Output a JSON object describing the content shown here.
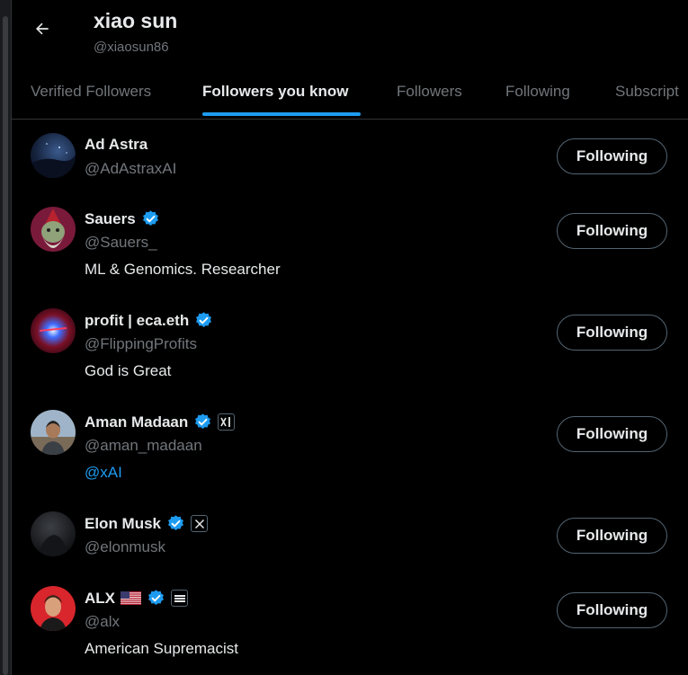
{
  "header": {
    "name": "xiao sun",
    "handle": "@xiaosun86"
  },
  "tabs": [
    {
      "label": "Verified Followers",
      "active": false
    },
    {
      "label": "Followers you know",
      "active": true
    },
    {
      "label": "Followers",
      "active": false
    },
    {
      "label": "Following",
      "active": false
    },
    {
      "label": "Subscript",
      "active": false
    }
  ],
  "accounts": [
    {
      "name": "Ad Astra",
      "handle": "@AdAstraxAI",
      "bio": "",
      "verified": false,
      "button": "Following"
    },
    {
      "name": "Sauers",
      "handle": "@Sauers_",
      "bio": "ML & Genomics. Researcher",
      "verified": true,
      "button": "Following"
    },
    {
      "name": "profit | eca.eth",
      "handle": "@FlippingProfits",
      "bio": "God is Great",
      "verified": true,
      "button": "Following"
    },
    {
      "name": "Aman Madaan",
      "handle": "@aman_madaan",
      "bio": "@xAI",
      "verified": true,
      "affiliate": "xAI",
      "button": "Following"
    },
    {
      "name": "Elon Musk",
      "handle": "@elonmusk",
      "bio": "",
      "verified": true,
      "affiliate": "X",
      "button": "Following"
    },
    {
      "name": "ALX",
      "handle": "@alx",
      "bio": "American Supremacist",
      "verified": true,
      "flag": "us-flag",
      "affiliate": "brand-badge",
      "button": "Following"
    }
  ],
  "colors": {
    "background": "#000000",
    "text": "#e7e9ea",
    "muted": "#71767b",
    "accent": "#1d9bf0",
    "border": "#2f3336"
  },
  "icons": [
    "back-arrow-icon",
    "verified-badge-icon",
    "xai-badge-icon",
    "x-badge-icon",
    "us-flag-icon"
  ]
}
